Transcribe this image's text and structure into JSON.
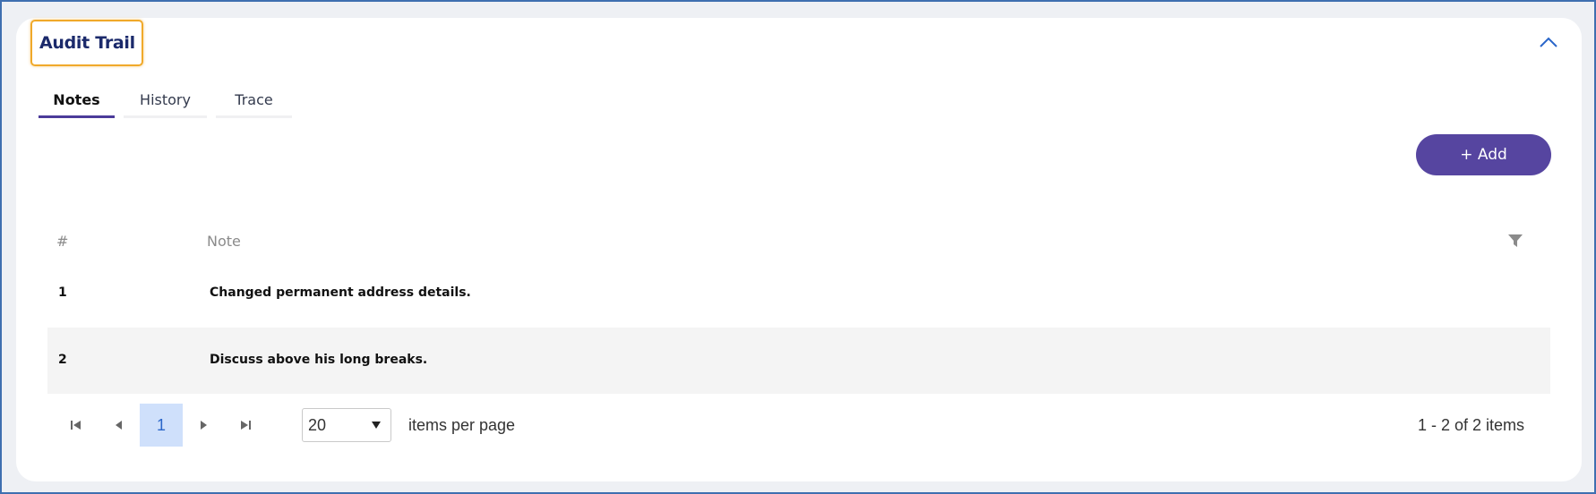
{
  "panel": {
    "title": "Audit Trail"
  },
  "tabs": [
    {
      "label": "Notes",
      "active": true
    },
    {
      "label": "History",
      "active": false
    },
    {
      "label": "Trace",
      "active": false
    }
  ],
  "toolbar": {
    "add_label": "+ Add"
  },
  "grid": {
    "columns": [
      "#",
      "Note"
    ],
    "rows": [
      {
        "num": "1",
        "note": "Changed permanent address details."
      },
      {
        "num": "2",
        "note": "Discuss above his long breaks."
      }
    ]
  },
  "pager": {
    "current_page": "1",
    "page_size": "20",
    "items_per_page_label": "items per page",
    "info": "1 - 2 of 2 items"
  },
  "colors": {
    "accent": "#5645a0",
    "title": "#1b2a6b",
    "highlight_border": "#f0a92a",
    "page_active_bg": "#cfe0fb"
  },
  "icons": [
    "chevron-up-icon",
    "filter-icon",
    "first-page-icon",
    "prev-page-icon",
    "next-page-icon",
    "last-page-icon",
    "caret-down-icon"
  ]
}
